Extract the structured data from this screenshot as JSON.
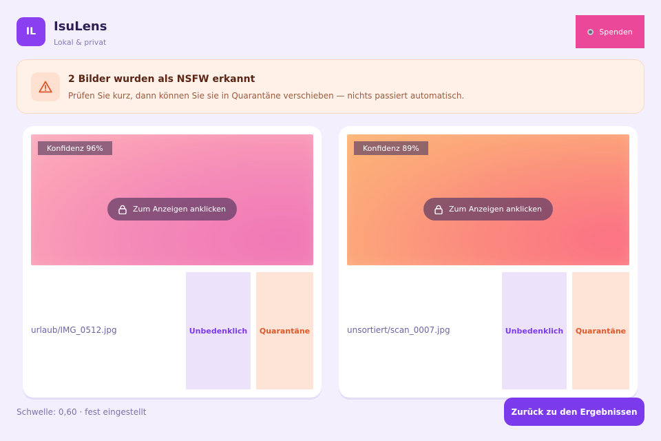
{
  "header": {
    "logo_text": "IL",
    "title": "IsuLens",
    "subtitle": "Lokal & privat",
    "donate_label": "Spenden"
  },
  "banner": {
    "icon": "warning-triangle-icon",
    "title": "2 Bilder wurden als NSFW erkannt",
    "text": "Prüfen Sie kurz, dann können Sie sie in Quarantäne verschieben — nichts passiert automatisch."
  },
  "cards": [
    {
      "confidence": "Konfidenz 96%",
      "reveal_label": "Zum Anzeigen anklicken",
      "filename": "urlaub/IMG_0512.jpg",
      "safe_label": "Unbedenklich",
      "quarantine_label": "Quarantäne"
    },
    {
      "confidence": "Konfidenz 89%",
      "reveal_label": "Zum Anzeigen anklicken",
      "filename": "unsortiert/scan_0007.jpg",
      "safe_label": "Unbedenklich",
      "quarantine_label": "Quarantäne"
    }
  ],
  "footer": {
    "threshold_text": "Schwelle: 0,60 · fest eingestellt",
    "back_label": "Zurück zu den Ergebnissen"
  },
  "colors": {
    "accent": "#7c3aed",
    "donate": "#ec4899",
    "warning_bg": "#fff1e8",
    "quarantine_text": "#dd5a2a"
  }
}
